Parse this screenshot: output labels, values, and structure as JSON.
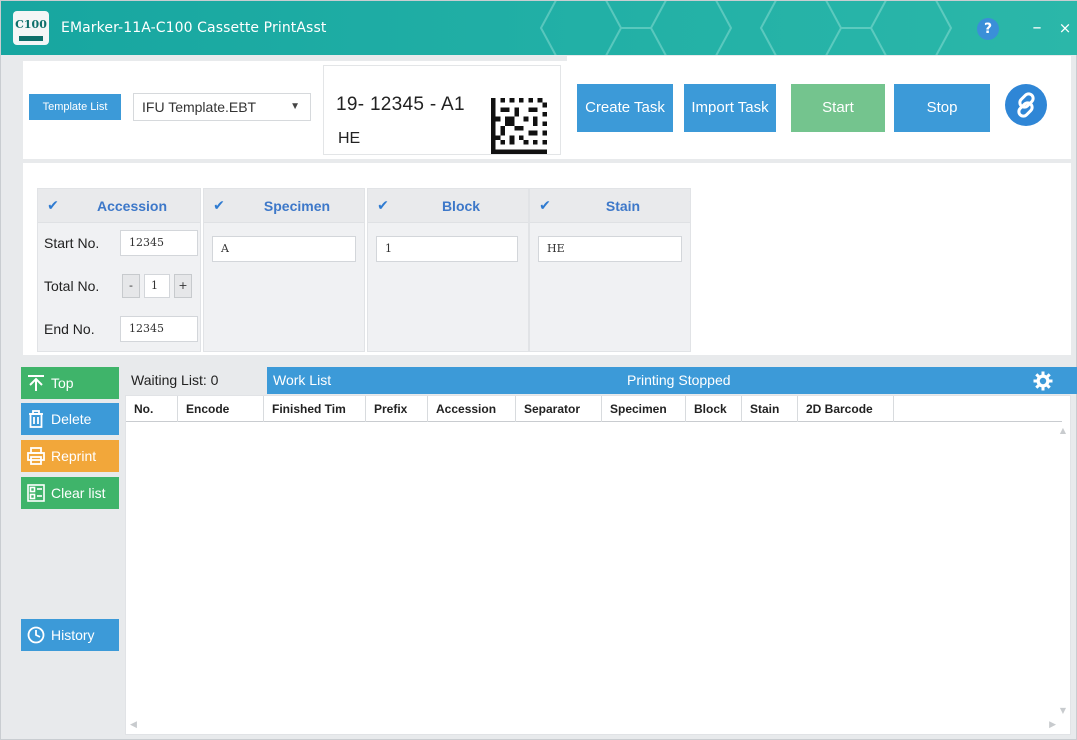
{
  "app": {
    "title": "EMarker-11A-C100 Cassette PrintAsst",
    "logo_text": "C100",
    "help_label": "?",
    "minimize_label": "–",
    "close_label": "×"
  },
  "template": {
    "button_label": "Template List",
    "selected": "IFU Template.EBT",
    "caret": "▼"
  },
  "preview": {
    "line1": "19- 12345 - A1",
    "line2": "HE"
  },
  "actions": {
    "create_task": "Create Task",
    "import_task": "Import Task",
    "start": "Start",
    "stop": "Stop"
  },
  "fields": {
    "accession": {
      "title": "Accession",
      "checked": true,
      "start_label": "Start  No.",
      "start_value": "12345",
      "total_label": "Total No.",
      "total_value": "1",
      "minus": "-",
      "plus": "+",
      "end_label": "End   No.",
      "end_value": "12345"
    },
    "specimen": {
      "title": "Specimen",
      "checked": true,
      "value": "A"
    },
    "block": {
      "title": "Block",
      "checked": true,
      "value": "1"
    },
    "stain": {
      "title": "Stain",
      "checked": true,
      "value": "HE"
    },
    "check_glyph": "✔"
  },
  "sidebar": {
    "top": "Top",
    "delete": "Delete",
    "reprint": "Reprint",
    "clear_list": "Clear list",
    "history": "History"
  },
  "worklist": {
    "waiting": "Waiting List: 0",
    "title": "Work List",
    "status": "Printing Stopped",
    "columns": [
      "No.",
      "Encode",
      "Finished Tim",
      "Prefix",
      "Accession",
      "Separator",
      "Specimen",
      "Block",
      "Stain",
      "2D Barcode"
    ],
    "rows": []
  },
  "colors": {
    "titlebar": "#1fada4",
    "primary_blue": "#3c9ad8",
    "start_green": "#74c48e",
    "sidebar_green": "#3fb46a",
    "reprint_orange": "#f2a73a",
    "header_text_blue": "#3d78c9"
  }
}
